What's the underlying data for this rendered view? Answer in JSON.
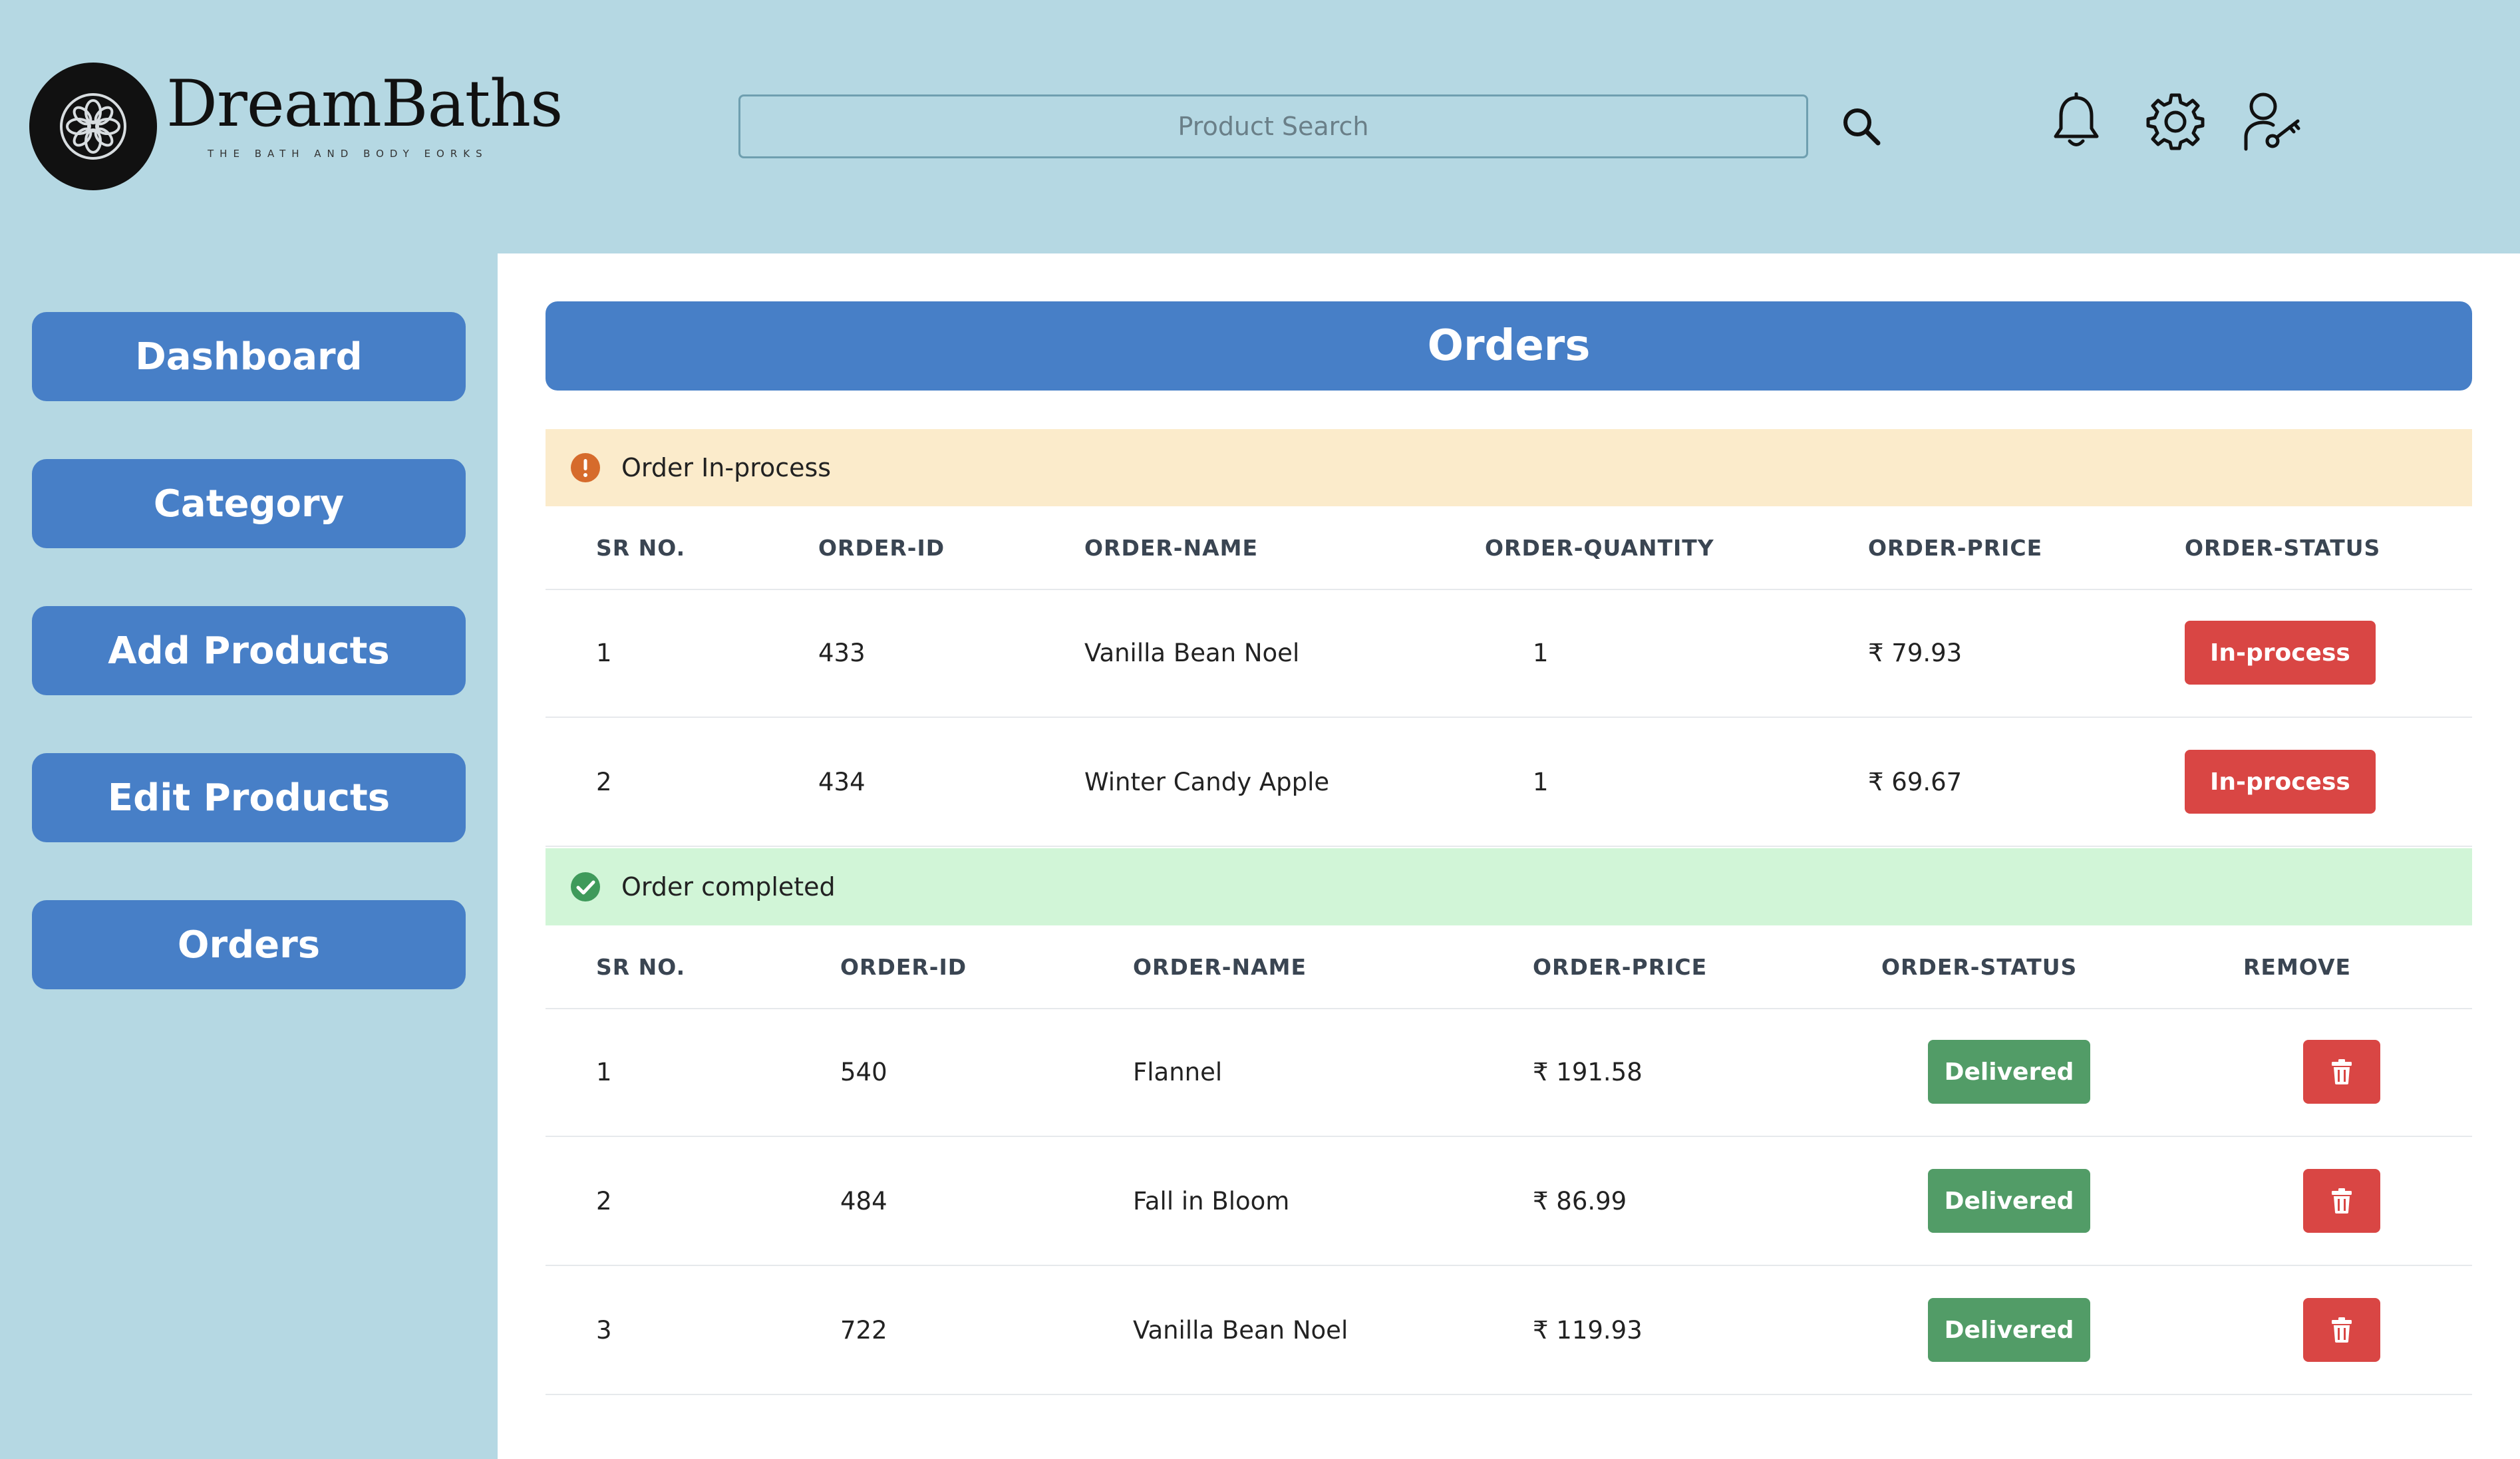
{
  "header": {
    "brand_name": "DreamBaths",
    "brand_tagline": "THE BATH AND BODY EORKS",
    "search_placeholder": "Product Search",
    "icons": [
      "search-icon",
      "bell-icon",
      "gear-icon",
      "user-key-icon"
    ]
  },
  "sidebar": {
    "items": [
      {
        "label": "Dashboard"
      },
      {
        "label": "Category"
      },
      {
        "label": "Add Products"
      },
      {
        "label": "Edit Products"
      },
      {
        "label": "Orders"
      }
    ]
  },
  "main": {
    "title": "Orders",
    "inprocess": {
      "banner": "Order In-process",
      "columns": [
        "SR NO.",
        "ORDER-ID",
        "ORDER-NAME",
        "ORDER-QUANTITY",
        "ORDER-PRICE",
        "ORDER-STATUS"
      ],
      "rows": [
        {
          "sr": "1",
          "id": "433",
          "name": "Vanilla Bean Noel",
          "qty": "1",
          "price": "₹ 79.93",
          "status": "In-process"
        },
        {
          "sr": "2",
          "id": "434",
          "name": "Winter Candy Apple",
          "qty": "1",
          "price": "₹ 69.67",
          "status": "In-process"
        }
      ]
    },
    "completed": {
      "banner": "Order completed",
      "columns": [
        "SR NO.",
        "ORDER-ID",
        "ORDER-NAME",
        "ORDER-PRICE",
        "ORDER-STATUS",
        "REMOVE"
      ],
      "rows": [
        {
          "sr": "1",
          "id": "540",
          "name": "Flannel",
          "price": "₹ 191.58",
          "status": "Delivered"
        },
        {
          "sr": "2",
          "id": "484",
          "name": "Fall in Bloom",
          "price": "₹ 86.99",
          "status": "Delivered"
        },
        {
          "sr": "3",
          "id": "722",
          "name": "Vanilla Bean Noel",
          "price": "₹ 119.93",
          "status": "Delivered"
        }
      ]
    }
  },
  "colors": {
    "background": "#b5d8e3",
    "primary": "#477fc7",
    "danger": "#d94644",
    "success": "#529c67",
    "warning_banner": "#fbebcb",
    "success_banner": "#d1f5d7"
  }
}
